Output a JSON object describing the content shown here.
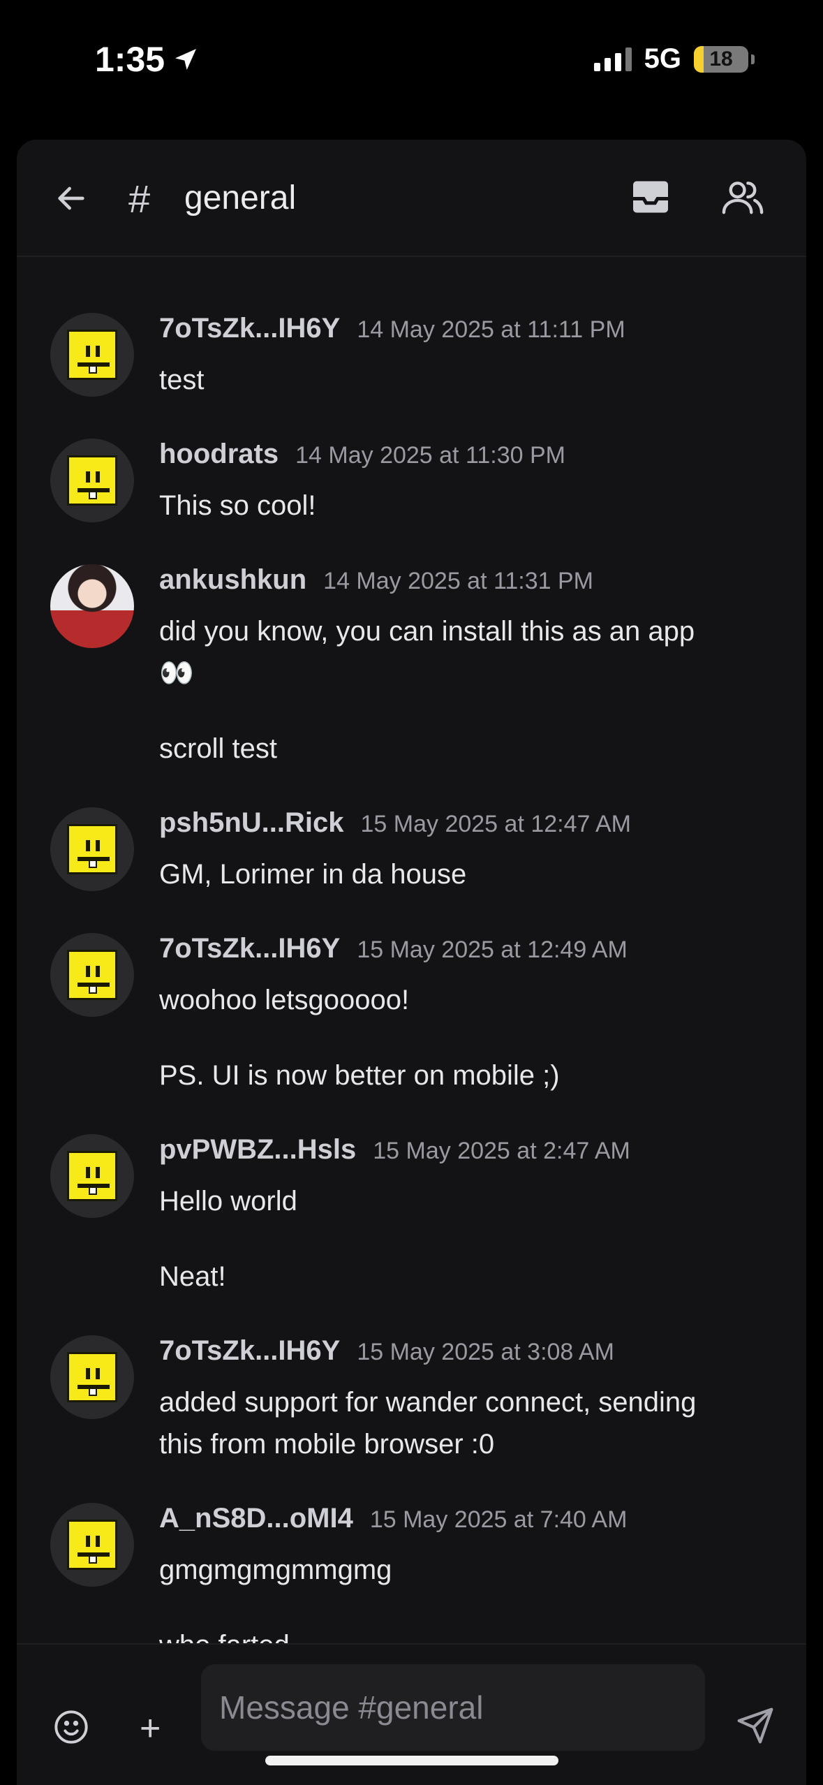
{
  "status_bar": {
    "time": "1:35",
    "network": "5G",
    "battery": "18",
    "battery_level": 0.18,
    "icons": [
      "location-arrow-icon",
      "cellular-signal-icon",
      "battery-icon"
    ]
  },
  "header": {
    "channel": "general",
    "hash": "#",
    "icons": [
      "back-arrow-icon",
      "hash-icon",
      "inbox-icon",
      "members-icon"
    ]
  },
  "messages": [
    {
      "author": "7oTsZk...IH6Y",
      "time": "14 May 2025 at 11:11 PM",
      "lines": [
        "test"
      ],
      "avatar": "pixel-face"
    },
    {
      "author": "hoodrats",
      "time": "14 May 2025 at 11:30 PM",
      "lines": [
        "This so cool!"
      ],
      "avatar": "pixel-face"
    },
    {
      "author": "ankushkun",
      "time": "14 May 2025 at 11:31 PM",
      "lines": [
        "did you know, you can install this as an app",
        "👀",
        "scroll test"
      ],
      "avatar": "photo"
    },
    {
      "author": "psh5nU...Rick",
      "time": "15 May 2025 at 12:47 AM",
      "lines": [
        "GM, Lorimer in da house"
      ],
      "avatar": "pixel-face"
    },
    {
      "author": "7oTsZk...IH6Y",
      "time": "15 May 2025 at 12:49 AM",
      "lines": [
        "woohoo letsgooooo!",
        "PS. UI is now better on mobile ;)"
      ],
      "avatar": "pixel-face"
    },
    {
      "author": "pvPWBZ...Hsls",
      "time": "15 May 2025 at 2:47 AM",
      "lines": [
        "Hello world",
        "Neat!"
      ],
      "avatar": "pixel-face"
    },
    {
      "author": "7oTsZk...IH6Y",
      "time": "15 May 2025 at 3:08 AM",
      "lines": [
        "added support for wander connect, sending",
        "this from mobile browser :0"
      ],
      "avatar": "pixel-face"
    },
    {
      "author": "A_nS8D...oMI4",
      "time": "15 May 2025 at 7:40 AM",
      "lines": [
        "gmgmgmgmmgmg",
        "who farted"
      ],
      "avatar": "pixel-face"
    }
  ],
  "composer": {
    "placeholder": "Message #general",
    "plus": "+",
    "icons": [
      "emoji-icon",
      "plus-icon",
      "send-icon"
    ]
  }
}
